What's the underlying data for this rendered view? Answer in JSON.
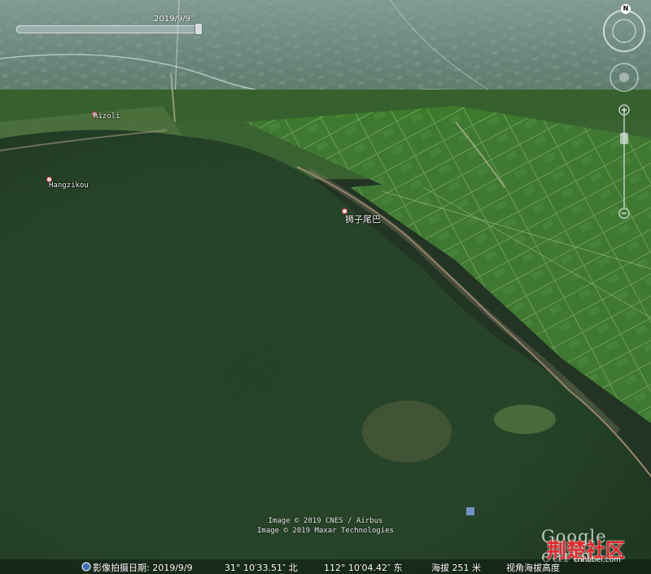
{
  "timeline": {
    "date": "2019/9/9"
  },
  "compass": {
    "north": "N"
  },
  "places": [
    {
      "label": "Aizoli"
    },
    {
      "label": "Hangzikou"
    },
    {
      "label": "狮子尾巴"
    }
  ],
  "attribution": {
    "line1": "Image © 2019 CNES / Airbus",
    "line2": "Image © 2019 Maxar Technologies"
  },
  "status_bar": {
    "imagery_date": "影像拍摄日期: 2019/9/9",
    "latitude": "31° 10′33.51″ 北",
    "longitude": "112° 10′04.42″ 东",
    "elevation": "海拔   251 米",
    "eye_alt": "视角海拔高度"
  },
  "watermarks": {
    "google": "Google earth",
    "site": "荆楚社区",
    "site_url": "cnhubei.com"
  },
  "colors": {
    "forest": "#1f3a22",
    "fields": "#3f7a2c",
    "haze": "#9fb4b4",
    "pin": "#e23b3b"
  }
}
